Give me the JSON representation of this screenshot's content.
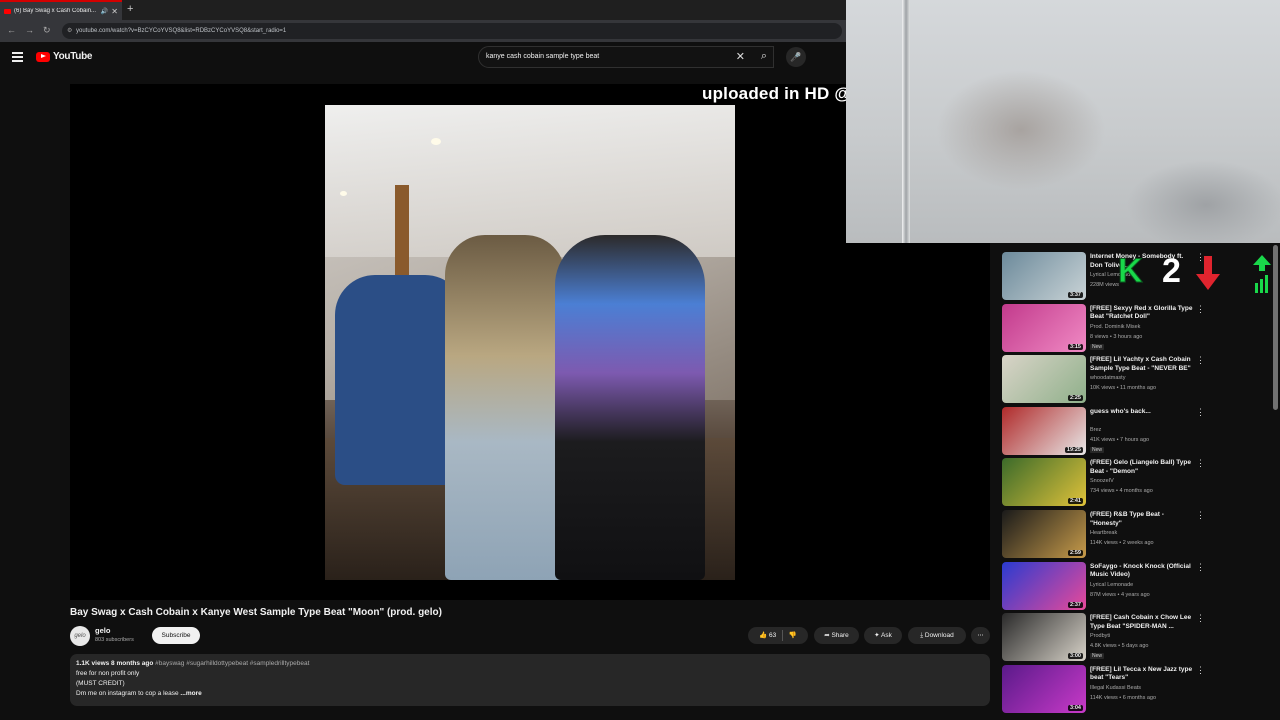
{
  "browser": {
    "tab_title": "(6) Bay Swag x Cash Cobain...",
    "url": "youtube.com/watch?v=BzCYCoYVSQ8&list=RDBzCYCoYVSQ8&start_radio=1"
  },
  "header": {
    "logo_text": "YouTube",
    "search_value": "kanye cash cobain sample type beat"
  },
  "overlay": {
    "banner_text": "uploaded in HD @",
    "k_letter": "K",
    "k_number": "2"
  },
  "video": {
    "title": "Bay Swag x Cash Cobain x Kanye West Sample Type Beat \"Moon\" (prod. gelo)",
    "channel": "gelo",
    "avatar_text": "gelo",
    "subscribers": "803 subscribers",
    "subscribe_label": "Subscribe",
    "likes": "63",
    "share_label": "Share",
    "ask_label": "Ask",
    "download_label": "Download",
    "description": {
      "views_date": "1.1K views  8 months ago",
      "tags": "#bayswag #sugarhilldottypebeat #sampledrilltypebeat",
      "line1": "free for non profit only",
      "line2": "(MUST CREDIT)",
      "line3": "Dm me on instagram to cop a lease",
      "more": "...more"
    }
  },
  "sidebar": {
    "items": [
      {
        "title": "Internet Money - Somebody ft. Don Toliver...",
        "channel": "Lyrical Lemonade",
        "views": "228M views",
        "duration": "3:37",
        "new": "",
        "colors": [
          "#6c8a9b",
          "#c9d3d6"
        ]
      },
      {
        "title": "[FREE] Sexyy Red x Glorilla Type Beat \"Ratchet Doll\"",
        "channel": "Prod. Dominik Misek",
        "views": "8 views • 3 hours ago",
        "duration": "3:15",
        "new": "New",
        "colors": [
          "#c23a8c",
          "#f08ac4"
        ]
      },
      {
        "title": "[FREE] Lil Yachty x Cash Cobain Sample Type Beat - \"NEVER BE\"",
        "channel": "whoodatmasty",
        "views": "10K views • 11 months ago",
        "duration": "2:25",
        "new": "",
        "colors": [
          "#d9d4c8",
          "#8fb08a"
        ]
      },
      {
        "title": "guess who's back...",
        "channel": "Brez",
        "views": "41K views • 7 hours ago",
        "duration": "19:25",
        "new": "New",
        "colors": [
          "#b02a2a",
          "#e8e8e8"
        ]
      },
      {
        "title": "(FREE) Gelo (Liangelo Ball) Type Beat - \"Demon\"",
        "channel": "SnoozeIV",
        "views": "734 views • 4 months ago",
        "duration": "2:41",
        "new": "",
        "colors": [
          "#3b6a2a",
          "#e0c23a"
        ]
      },
      {
        "title": "(FREE) R&B Type Beat - \"Honesty\"",
        "channel": "Heartbreak",
        "views": "114K views • 2 weeks ago",
        "duration": "2:59",
        "new": "",
        "colors": [
          "#1a1a1a",
          "#c79b4a"
        ]
      },
      {
        "title": "SoFaygo - Knock Knock (Official Music Video)",
        "channel": "Lyrical Lemonade",
        "views": "87M views • 4 years ago",
        "duration": "2:37",
        "new": "",
        "colors": [
          "#2a3bd0",
          "#e84a9a"
        ]
      },
      {
        "title": "[FREE] Cash Cobain x Chow Lee Type Beat \"SPIDER-MAN ...",
        "channel": "Prodbyti",
        "views": "4.8K views • 5 days ago",
        "duration": "3:00",
        "new": "New",
        "colors": [
          "#2a2a2a",
          "#d7d2c8"
        ]
      },
      {
        "title": "[FREE] Lil Tecca x New Jazz type beat \"Tears\"",
        "channel": "Illegal Kudassi Beats",
        "views": "114K views • 6 months ago",
        "duration": "3:04",
        "new": "",
        "colors": [
          "#5a1a8a",
          "#c83ac8"
        ]
      }
    ]
  }
}
